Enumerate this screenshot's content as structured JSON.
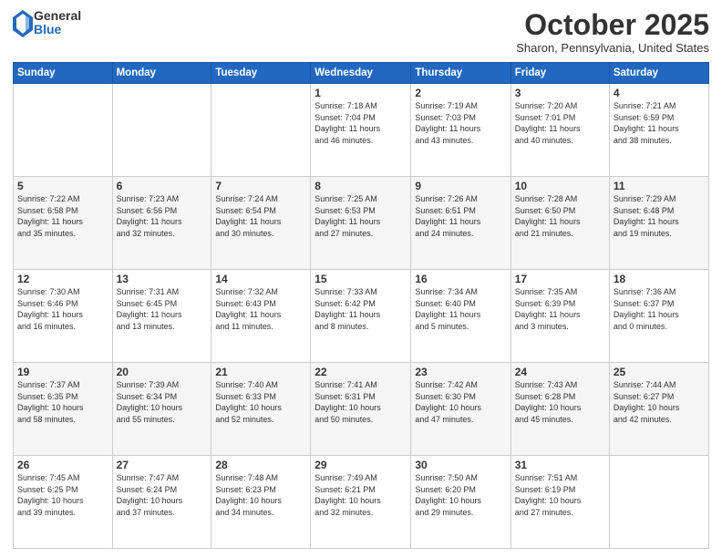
{
  "header": {
    "logo_general": "General",
    "logo_blue": "Blue",
    "month_title": "October 2025",
    "location": "Sharon, Pennsylvania, United States"
  },
  "days_of_week": [
    "Sunday",
    "Monday",
    "Tuesday",
    "Wednesday",
    "Thursday",
    "Friday",
    "Saturday"
  ],
  "weeks": [
    [
      {
        "day": "",
        "info": ""
      },
      {
        "day": "",
        "info": ""
      },
      {
        "day": "",
        "info": ""
      },
      {
        "day": "1",
        "info": "Sunrise: 7:18 AM\nSunset: 7:04 PM\nDaylight: 11 hours\nand 46 minutes."
      },
      {
        "day": "2",
        "info": "Sunrise: 7:19 AM\nSunset: 7:03 PM\nDaylight: 11 hours\nand 43 minutes."
      },
      {
        "day": "3",
        "info": "Sunrise: 7:20 AM\nSunset: 7:01 PM\nDaylight: 11 hours\nand 40 minutes."
      },
      {
        "day": "4",
        "info": "Sunrise: 7:21 AM\nSunset: 6:59 PM\nDaylight: 11 hours\nand 38 minutes."
      }
    ],
    [
      {
        "day": "5",
        "info": "Sunrise: 7:22 AM\nSunset: 6:58 PM\nDaylight: 11 hours\nand 35 minutes."
      },
      {
        "day": "6",
        "info": "Sunrise: 7:23 AM\nSunset: 6:56 PM\nDaylight: 11 hours\nand 32 minutes."
      },
      {
        "day": "7",
        "info": "Sunrise: 7:24 AM\nSunset: 6:54 PM\nDaylight: 11 hours\nand 30 minutes."
      },
      {
        "day": "8",
        "info": "Sunrise: 7:25 AM\nSunset: 6:53 PM\nDaylight: 11 hours\nand 27 minutes."
      },
      {
        "day": "9",
        "info": "Sunrise: 7:26 AM\nSunset: 6:51 PM\nDaylight: 11 hours\nand 24 minutes."
      },
      {
        "day": "10",
        "info": "Sunrise: 7:28 AM\nSunset: 6:50 PM\nDaylight: 11 hours\nand 21 minutes."
      },
      {
        "day": "11",
        "info": "Sunrise: 7:29 AM\nSunset: 6:48 PM\nDaylight: 11 hours\nand 19 minutes."
      }
    ],
    [
      {
        "day": "12",
        "info": "Sunrise: 7:30 AM\nSunset: 6:46 PM\nDaylight: 11 hours\nand 16 minutes."
      },
      {
        "day": "13",
        "info": "Sunrise: 7:31 AM\nSunset: 6:45 PM\nDaylight: 11 hours\nand 13 minutes."
      },
      {
        "day": "14",
        "info": "Sunrise: 7:32 AM\nSunset: 6:43 PM\nDaylight: 11 hours\nand 11 minutes."
      },
      {
        "day": "15",
        "info": "Sunrise: 7:33 AM\nSunset: 6:42 PM\nDaylight: 11 hours\nand 8 minutes."
      },
      {
        "day": "16",
        "info": "Sunrise: 7:34 AM\nSunset: 6:40 PM\nDaylight: 11 hours\nand 5 minutes."
      },
      {
        "day": "17",
        "info": "Sunrise: 7:35 AM\nSunset: 6:39 PM\nDaylight: 11 hours\nand 3 minutes."
      },
      {
        "day": "18",
        "info": "Sunrise: 7:36 AM\nSunset: 6:37 PM\nDaylight: 11 hours\nand 0 minutes."
      }
    ],
    [
      {
        "day": "19",
        "info": "Sunrise: 7:37 AM\nSunset: 6:35 PM\nDaylight: 10 hours\nand 58 minutes."
      },
      {
        "day": "20",
        "info": "Sunrise: 7:39 AM\nSunset: 6:34 PM\nDaylight: 10 hours\nand 55 minutes."
      },
      {
        "day": "21",
        "info": "Sunrise: 7:40 AM\nSunset: 6:33 PM\nDaylight: 10 hours\nand 52 minutes."
      },
      {
        "day": "22",
        "info": "Sunrise: 7:41 AM\nSunset: 6:31 PM\nDaylight: 10 hours\nand 50 minutes."
      },
      {
        "day": "23",
        "info": "Sunrise: 7:42 AM\nSunset: 6:30 PM\nDaylight: 10 hours\nand 47 minutes."
      },
      {
        "day": "24",
        "info": "Sunrise: 7:43 AM\nSunset: 6:28 PM\nDaylight: 10 hours\nand 45 minutes."
      },
      {
        "day": "25",
        "info": "Sunrise: 7:44 AM\nSunset: 6:27 PM\nDaylight: 10 hours\nand 42 minutes."
      }
    ],
    [
      {
        "day": "26",
        "info": "Sunrise: 7:45 AM\nSunset: 6:25 PM\nDaylight: 10 hours\nand 39 minutes."
      },
      {
        "day": "27",
        "info": "Sunrise: 7:47 AM\nSunset: 6:24 PM\nDaylight: 10 hours\nand 37 minutes."
      },
      {
        "day": "28",
        "info": "Sunrise: 7:48 AM\nSunset: 6:23 PM\nDaylight: 10 hours\nand 34 minutes."
      },
      {
        "day": "29",
        "info": "Sunrise: 7:49 AM\nSunset: 6:21 PM\nDaylight: 10 hours\nand 32 minutes."
      },
      {
        "day": "30",
        "info": "Sunrise: 7:50 AM\nSunset: 6:20 PM\nDaylight: 10 hours\nand 29 minutes."
      },
      {
        "day": "31",
        "info": "Sunrise: 7:51 AM\nSunset: 6:19 PM\nDaylight: 10 hours\nand 27 minutes."
      },
      {
        "day": "",
        "info": ""
      }
    ]
  ]
}
